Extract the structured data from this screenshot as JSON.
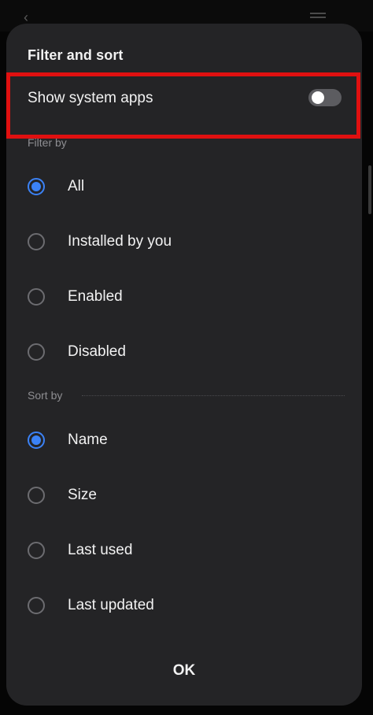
{
  "dialog": {
    "title": "Filter and sort",
    "show_system_apps": {
      "label": "Show system apps",
      "enabled": false
    },
    "filter_by": {
      "label": "Filter by",
      "options": [
        {
          "label": "All",
          "selected": true
        },
        {
          "label": "Installed by you",
          "selected": false
        },
        {
          "label": "Enabled",
          "selected": false
        },
        {
          "label": "Disabled",
          "selected": false
        }
      ]
    },
    "sort_by": {
      "label": "Sort by",
      "options": [
        {
          "label": "Name",
          "selected": true
        },
        {
          "label": "Size",
          "selected": false
        },
        {
          "label": "Last used",
          "selected": false
        },
        {
          "label": "Last updated",
          "selected": false
        }
      ]
    },
    "ok_label": "OK"
  },
  "colors": {
    "dialog_background": "#242426",
    "accent": "#3b82f6",
    "highlight": "#e01010",
    "text_primary": "#f2f2f2",
    "text_secondary": "#8e8e92"
  }
}
